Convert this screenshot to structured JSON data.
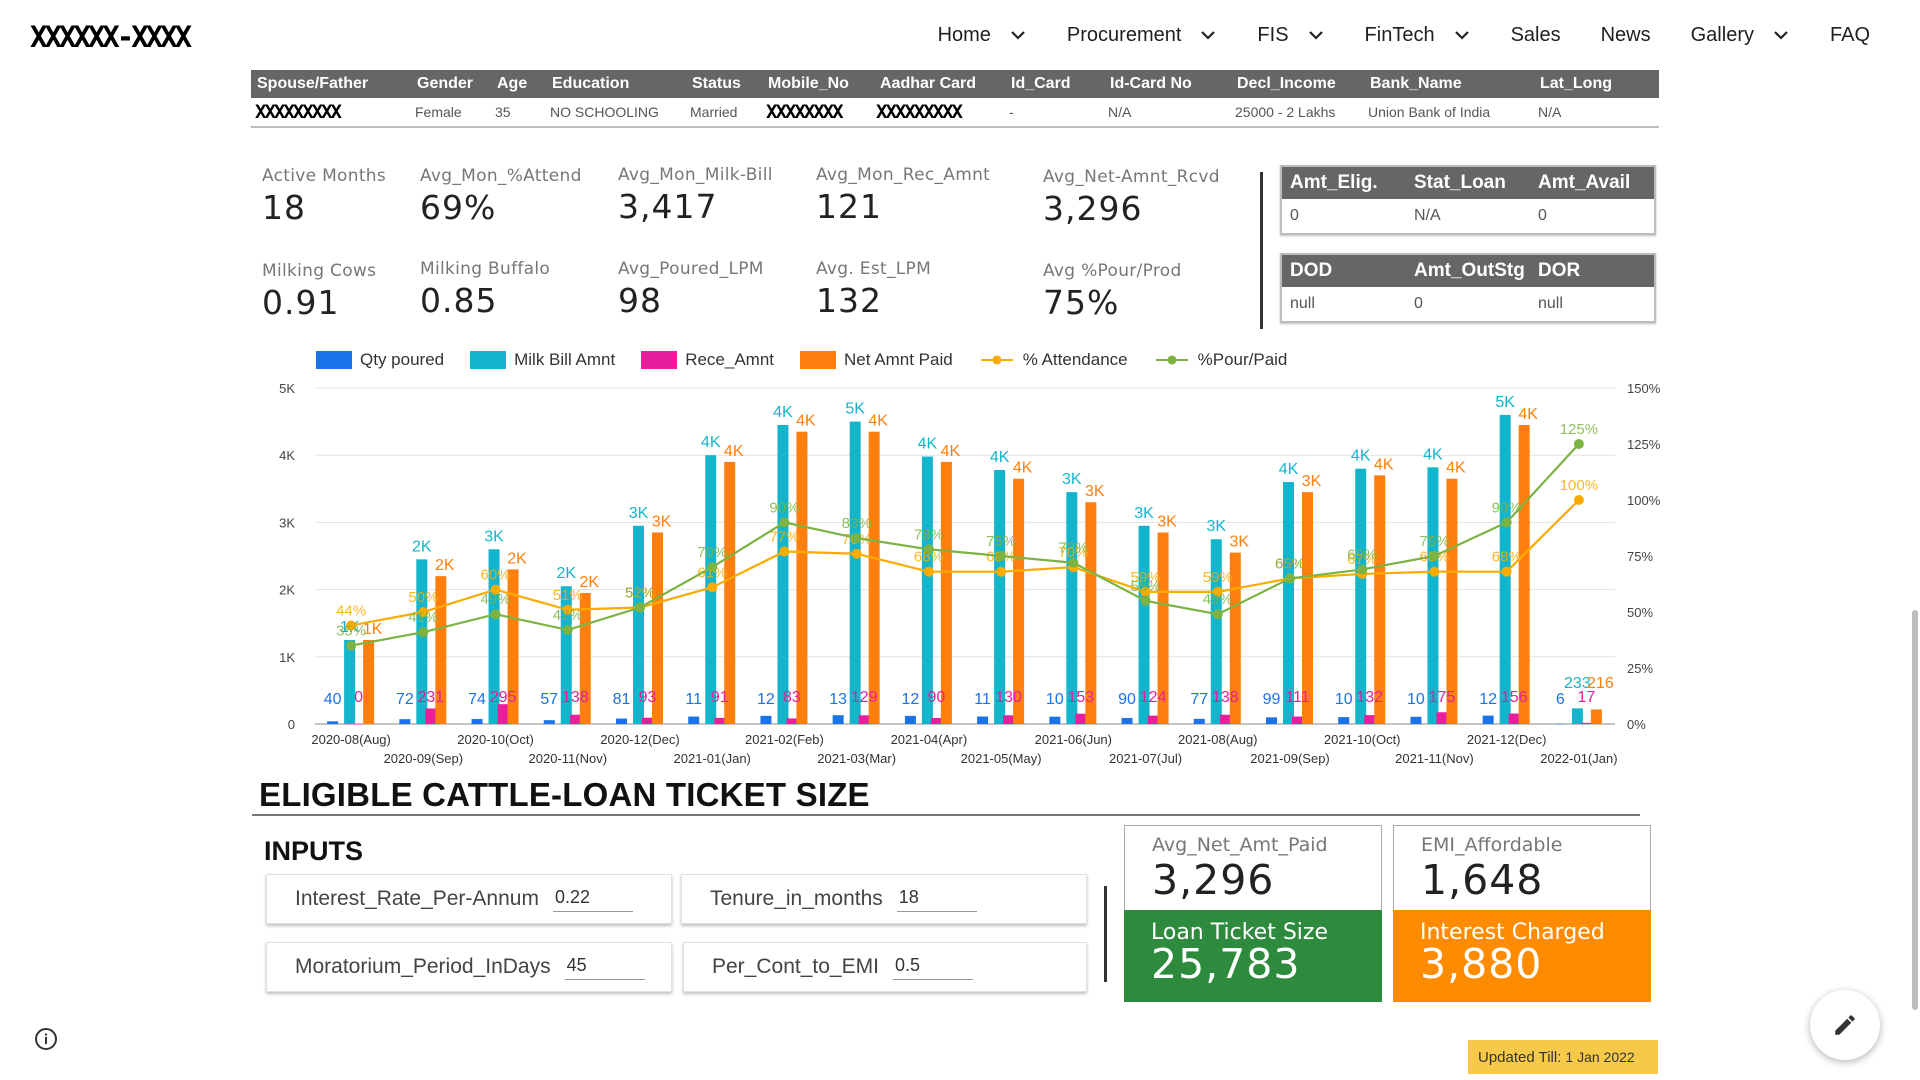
{
  "nav": {
    "logo": "XXXXXX-XXXX",
    "items": [
      {
        "label": "Home",
        "dropdown": true
      },
      {
        "label": "Procurement",
        "dropdown": true
      },
      {
        "label": "FIS",
        "dropdown": true
      },
      {
        "label": "FinTech",
        "dropdown": true
      },
      {
        "label": "Sales",
        "dropdown": false
      },
      {
        "label": "News",
        "dropdown": false
      },
      {
        "label": "Gallery",
        "dropdown": true
      },
      {
        "label": "FAQ",
        "dropdown": false
      }
    ]
  },
  "profile": {
    "headers": [
      "Spouse/Father",
      "Gender",
      "Age",
      "Education",
      "Status",
      "Mobile_No",
      "Aadhar Card",
      "Id_Card",
      "Id-Card No",
      "Decl_Income",
      "Bank_Name",
      "Lat_Long"
    ],
    "row": [
      "XXXXXXXXX",
      "Female",
      "35",
      "NO SCHOOLING",
      "Married",
      "XXXXXXXX",
      "XXXXXXXXX",
      "-",
      "N/A",
      "25000 - 2 Lakhs",
      "Union Bank of India",
      "N/A"
    ]
  },
  "kpis": {
    "active_months": {
      "label": "Active Months",
      "value": "18"
    },
    "avg_attend": {
      "label": "Avg_Mon_%Attend",
      "value": "69%"
    },
    "avg_milk_bill": {
      "label": "Avg_Mon_Milk-Bill",
      "value": "3,417"
    },
    "avg_rec_amnt": {
      "label": "Avg_Mon_Rec_Amnt",
      "value": "121"
    },
    "avg_net_amnt": {
      "label": "Avg_Net-Amnt_Rcvd",
      "value": "3,296"
    },
    "milking_cows": {
      "label": "Milking Cows",
      "value": "0.91"
    },
    "milking_buffalo": {
      "label": "Milking Buffalo",
      "value": "0.85"
    },
    "avg_poured_lpm": {
      "label": "Avg_Poured_LPM",
      "value": "98"
    },
    "avg_est_lpm": {
      "label": "Avg. Est_LPM",
      "value": "132"
    },
    "avg_pour_prod": {
      "label": "Avg %Pour/Prod",
      "value": "75%"
    }
  },
  "loan_table": {
    "headers": [
      "Amt_Elig.",
      "Stat_Loan",
      "Amt_Avail"
    ],
    "row": [
      "0",
      "N/A",
      "0"
    ]
  },
  "dod_table": {
    "headers": [
      "DOD",
      "Amt_OutStg",
      "DOR"
    ],
    "row": [
      "null",
      "0",
      "null"
    ]
  },
  "colors": {
    "qty": "#1a73e8",
    "milk_bill": "#12b5cb",
    "rece": "#e91e9c",
    "net_paid": "#ff7f0e",
    "attendance": "#f9ab00",
    "pour_paid": "#7cb342"
  },
  "chart_data": {
    "type": "bar",
    "legend": [
      "Qty poured",
      "Milk Bill Amnt",
      "Rece_Amnt",
      "Net Amnt Paid",
      "% Attendance",
      "%Pour/Paid"
    ],
    "legend_position": "top",
    "categories": [
      "2020-08(Aug)",
      "2020-09(Sep)",
      "2020-10(Oct)",
      "2020-11(Nov)",
      "2020-12(Dec)",
      "2021-01(Jan)",
      "2021-02(Feb)",
      "2021-03(Mar)",
      "2021-04(Apr)",
      "2021-05(May)",
      "2021-06(Jun)",
      "2021-07(Jul)",
      "2021-08(Aug)",
      "2021-09(Sep)",
      "2021-10(Oct)",
      "2021-11(Nov)",
      "2021-12(Dec)",
      "2022-01(Jan)"
    ],
    "y_left": {
      "ticks": [
        "0",
        "1K",
        "2K",
        "3K",
        "4K",
        "5K"
      ],
      "lim": [
        0,
        5000
      ]
    },
    "y_right": {
      "ticks": [
        "0%",
        "25%",
        "50%",
        "75%",
        "100%",
        "125%",
        "150%"
      ],
      "lim": [
        0,
        150
      ]
    },
    "series": [
      {
        "name": "Qty poured",
        "axis": "left",
        "kind": "bar",
        "values": [
          40,
          72,
          74,
          57,
          81,
          111,
          121,
          131,
          121,
          111,
          109,
          90,
          77,
          99,
          103,
          107,
          125,
          6
        ],
        "labels": [
          "40",
          "72",
          "74",
          "57",
          "81",
          "11",
          "12",
          "13",
          "12",
          "11",
          "10",
          "90",
          "77",
          "99",
          "10",
          "10",
          "12",
          "6"
        ]
      },
      {
        "name": "Milk Bill Amnt",
        "axis": "left",
        "kind": "bar",
        "values": [
          1250,
          2450,
          2600,
          2050,
          2950,
          4000,
          4450,
          4500,
          3980,
          3780,
          3450,
          2950,
          2750,
          3600,
          3800,
          3820,
          4600,
          233
        ],
        "labels": [
          "1K",
          "2K",
          "3K",
          "2K",
          "3K",
          "4K",
          "4K",
          "5K",
          "4K",
          "4K",
          "3K",
          "3K",
          "3K",
          "4K",
          "4K",
          "4K",
          "5K",
          "233"
        ]
      },
      {
        "name": "Rece_Amnt",
        "axis": "left",
        "kind": "bar",
        "values": [
          0,
          231,
          295,
          138,
          93,
          91,
          83,
          129,
          90,
          130,
          153,
          124,
          138,
          111,
          132,
          175,
          156,
          17
        ],
        "labels": [
          "0",
          "231",
          "295",
          "138",
          "93",
          "91",
          "83",
          "129",
          "90",
          "130",
          "153",
          "124",
          "138",
          "111",
          "132",
          "175",
          "156",
          "17"
        ]
      },
      {
        "name": "Net Amnt Paid",
        "axis": "left",
        "kind": "bar",
        "values": [
          1250,
          2200,
          2300,
          1950,
          2850,
          3900,
          4350,
          4350,
          3900,
          3650,
          3300,
          2850,
          2550,
          3450,
          3700,
          3650,
          4450,
          216
        ],
        "labels": [
          "1K",
          "2K",
          "2K",
          "2K",
          "3K",
          "4K",
          "4K",
          "4K",
          "4K",
          "4K",
          "3K",
          "3K",
          "3K",
          "3K",
          "4K",
          "4K",
          "4K",
          "216"
        ]
      },
      {
        "name": "% Attendance",
        "axis": "right",
        "kind": "line",
        "values": [
          44,
          50,
          60,
          51,
          52,
          61,
          77,
          76,
          68,
          68,
          70,
          59,
          59,
          65,
          67,
          68,
          68,
          100
        ],
        "labels": [
          "44%",
          "50%",
          "60%",
          "51%",
          "52%",
          "61%",
          "77%",
          "76%",
          "68%",
          "68%",
          "70%",
          "59%",
          "59%",
          "65%",
          "67%",
          "68%",
          "68%",
          "100%"
        ]
      },
      {
        "name": "%Pour/Paid",
        "axis": "right",
        "kind": "line",
        "values": [
          35,
          41,
          49,
          42,
          52,
          70,
          90,
          83,
          78,
          75,
          72,
          55,
          49,
          65,
          69,
          75,
          90,
          125
        ],
        "labels": [
          "35%",
          "41%",
          "49%",
          "42%",
          "52%",
          "70%",
          "90%",
          "83%",
          "78%",
          "75%",
          "72%",
          "55%",
          "49%",
          "65%",
          "69%",
          "75%",
          "90%",
          "125%"
        ]
      }
    ]
  },
  "loan_section": {
    "title": "ELIGIBLE CATTLE-LOAN TICKET SIZE",
    "inputs_title": "INPUTS",
    "inputs": {
      "interest": {
        "label": "Interest_Rate_Per-Annum",
        "value": "0.22"
      },
      "tenure": {
        "label": "Tenure_in_months",
        "value": "18"
      },
      "moratorium": {
        "label": "Moratorium_Period_InDays",
        "value": "45"
      },
      "per_cont": {
        "label": "Per_Cont_to_EMI",
        "value": "0.5"
      }
    },
    "cards": {
      "avg_net": {
        "label": "Avg_Net_Amt_Paid",
        "value": "3,296"
      },
      "emi": {
        "label": "EMI_Affordable",
        "value": "1,648"
      },
      "ticket": {
        "label": "Loan Ticket Size",
        "value": "25,783"
      },
      "interest": {
        "label": "Interest Charged",
        "value": "3,880"
      }
    }
  },
  "footer": {
    "updated_label": "Updated Till:",
    "updated_date": "1 Jan 2022"
  }
}
